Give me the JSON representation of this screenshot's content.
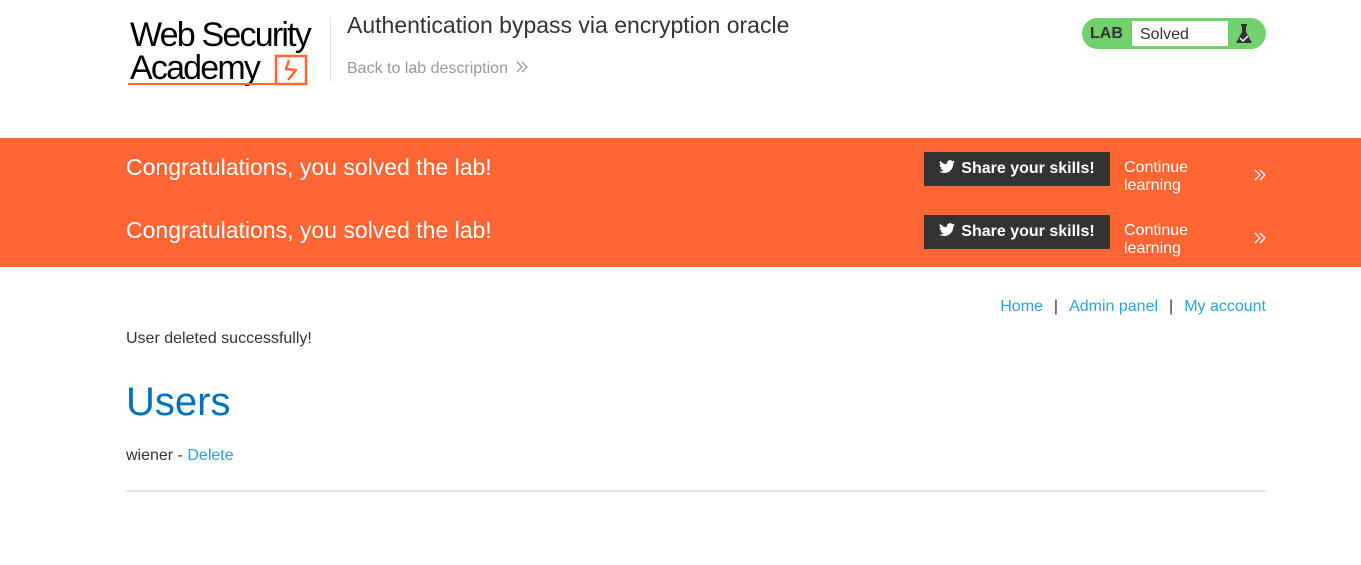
{
  "header": {
    "logo_line1": "Web Security",
    "logo_line2": "Academy",
    "lab_title": "Authentication bypass via encryption oracle",
    "back_link": "Back to lab description",
    "lab_badge": "LAB",
    "lab_state": "Solved"
  },
  "banner": {
    "rows": [
      {
        "message": "Congratulations, you solved the lab!",
        "share_label": "Share your skills!",
        "continue_label": "Continue learning"
      },
      {
        "message": "Congratulations, you solved the lab!",
        "share_label": "Share your skills!",
        "continue_label": "Continue learning"
      }
    ]
  },
  "nav": {
    "home": "Home",
    "admin_panel": "Admin panel",
    "my_account": "My account",
    "separator": "|"
  },
  "main": {
    "message": "User deleted successfully!",
    "heading": "Users",
    "users": [
      {
        "name": "wiener",
        "separator": " - ",
        "action": "Delete"
      }
    ]
  },
  "colors": {
    "accent": "#ff6633",
    "link": "#29a5dc",
    "heading": "#0071bc",
    "solved": "#70d16d"
  },
  "icons": [
    "academy-logo-icon",
    "chevron-right-icon",
    "flask-icon",
    "twitter-icon"
  ]
}
